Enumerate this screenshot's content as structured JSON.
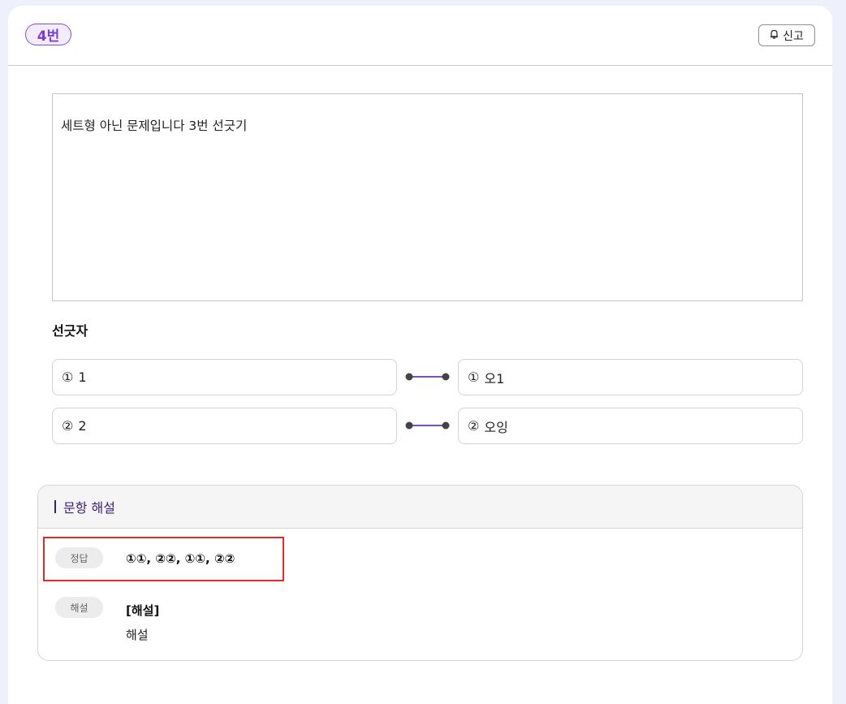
{
  "header": {
    "question_number": "4번",
    "report_label": "신고"
  },
  "question": {
    "text": "세트형 아닌 문제입니다 3번 선긋기"
  },
  "matching": {
    "title": "선긋자",
    "left_items": [
      {
        "num": "①",
        "label": "1"
      },
      {
        "num": "②",
        "label": "2"
      }
    ],
    "right_items": [
      {
        "num": "①",
        "label": "오1"
      },
      {
        "num": "②",
        "label": "오잉"
      }
    ]
  },
  "explanation": {
    "heading": "문항 해설",
    "answer_label": "정답",
    "answer_value": "①①, ②②, ①①, ②②",
    "explain_label": "해설",
    "explain_title": "[해설]",
    "explain_body": "해설"
  },
  "colors": {
    "accent": "#8a4ad8",
    "connector_line": "#7a4ad8",
    "highlight": "#e12a2a"
  },
  "icons": {
    "report": "bell-icon"
  }
}
